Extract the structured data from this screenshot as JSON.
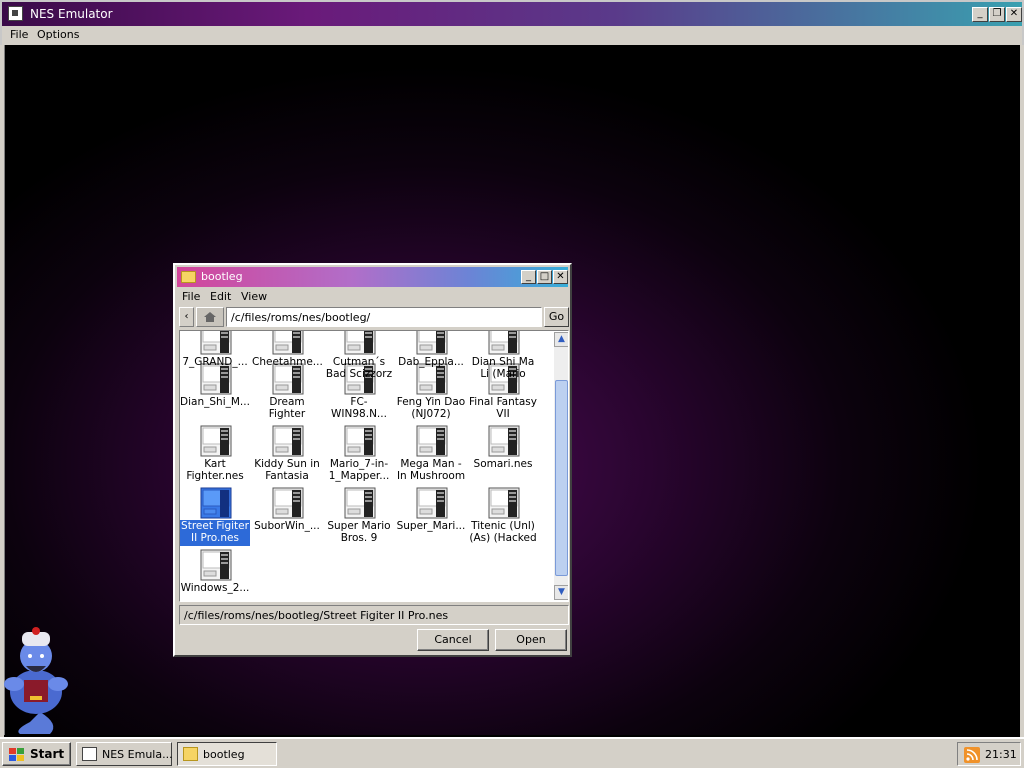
{
  "main_window": {
    "title": "NES Emulator",
    "menu": [
      "File",
      "Options"
    ]
  },
  "dialog": {
    "title": "bootleg",
    "menu": [
      "File",
      "Edit",
      "View"
    ],
    "path": "/c/files/roms/nes/bootleg/",
    "go_label": "Go",
    "selected_path": "/c/files/roms/nes/bootleg/Street Figiter II Pro.nes",
    "cancel_label": "Cancel",
    "open_label": "Open",
    "files": [
      [
        "7_GRAND_...",
        "Cheetahme...",
        "Cutman´s Bad Scizzorz",
        "Dab_Eppla...",
        "Dian Shi Ma Li (Mario"
      ],
      [
        "Dian_Shi_M...",
        "Dream Fighter",
        "FC-WIN98.N...",
        "Feng Yin Dao (NJ072)",
        "Final Fantasy VII"
      ],
      [
        "Kart Fighter.nes",
        "Kiddy Sun in Fantasia",
        "Mario_7-in-1_Mapper...",
        "Mega Man - In Mushroom",
        "Somari.nes"
      ],
      [
        "Street Figiter II Pro.nes",
        "SuborWin_...",
        "Super Mario Bros. 9",
        "Super_Mari...",
        "Titenic (Unl) (As) (Hacked"
      ],
      [
        "Windows_2..."
      ]
    ],
    "selected_file": "Street Figiter II Pro.nes"
  },
  "taskbar": {
    "start_label": "Start",
    "tasks": [
      "NES Emula...",
      "bootleg"
    ],
    "active_task": "bootleg",
    "clock": "21:31"
  },
  "icons": {
    "window_app": "window-app-icon",
    "folder": "folder-icon",
    "file": "nes-console-icon",
    "home": "home-icon",
    "rss": "rss-icon",
    "start": "windows-logo-icon"
  }
}
